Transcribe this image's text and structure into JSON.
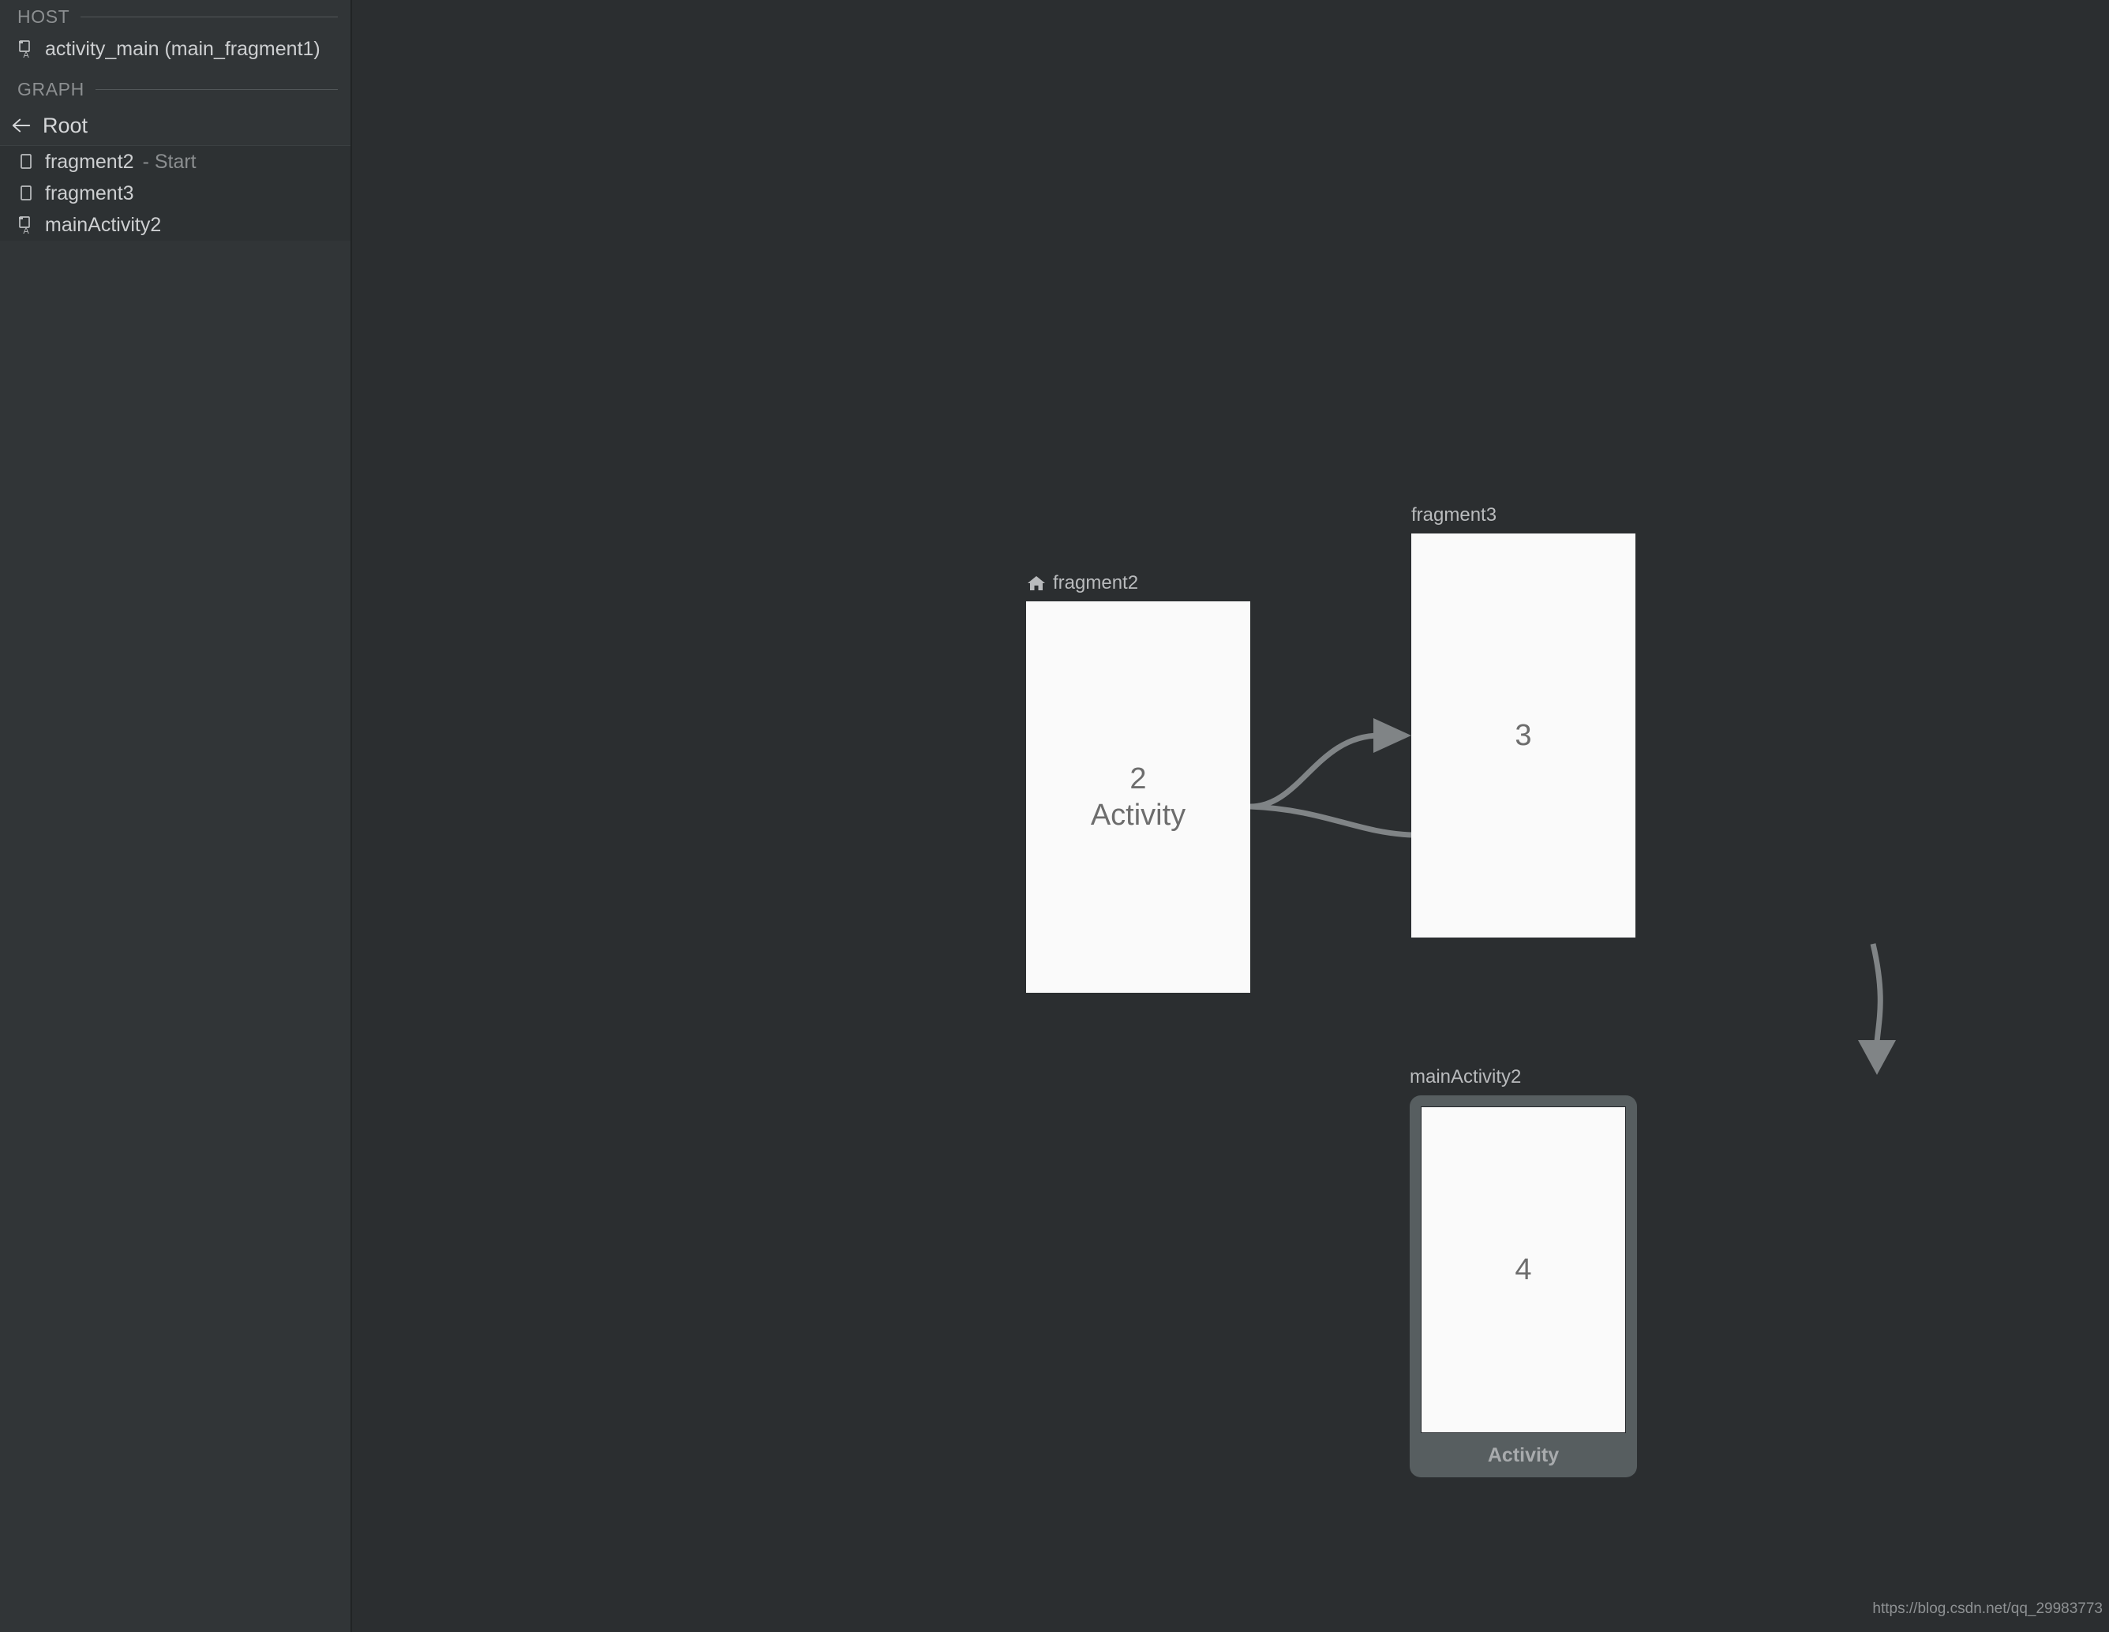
{
  "sidebar": {
    "sections": [
      {
        "title": "HOST"
      },
      {
        "title": "GRAPH"
      }
    ],
    "host_items": [
      {
        "label": "activity_main (main_fragment1)",
        "icon": "activity-layout-icon"
      }
    ],
    "back_item": {
      "label": "Root",
      "icon": "back-arrow-icon"
    },
    "graph_items": [
      {
        "label": "fragment2",
        "suffix": "- Start",
        "icon": "fragment-icon"
      },
      {
        "label": "fragment3",
        "suffix": "",
        "icon": "fragment-icon"
      },
      {
        "label": "mainActivity2",
        "suffix": "",
        "icon": "activity-layout-icon"
      }
    ]
  },
  "canvas": {
    "destinations": [
      {
        "id": "fragment2",
        "label": "fragment2",
        "icon": "home-icon",
        "is_start": true,
        "kind": "fragment",
        "card_id": "2",
        "card_type": "Activity"
      },
      {
        "id": "fragment3",
        "label": "fragment3",
        "icon": "",
        "is_start": false,
        "kind": "fragment",
        "card_id": "3",
        "card_type": ""
      },
      {
        "id": "mainActivity2",
        "label": "mainActivity2",
        "icon": "",
        "is_start": false,
        "kind": "activity",
        "card_id": "4",
        "card_type": "Activity"
      }
    ],
    "actions": [
      {
        "from": "fragment2",
        "to": "fragment3",
        "arrow": true
      },
      {
        "from": "fragment2",
        "to": "fragment3",
        "arrow": false
      },
      {
        "from": "fragment3",
        "to": "mainActivity2",
        "arrow": true
      }
    ]
  },
  "watermark": "https://blog.csdn.net/qq_29983773",
  "colors": {
    "canvas_bg": "#2b2e30",
    "sidebar_bg": "#313537",
    "card_bg": "#fafafa",
    "card_text": "#6d6d6d",
    "connector": "#808486",
    "activity_frame": "#575e60",
    "label_text": "#b9bbbd"
  }
}
